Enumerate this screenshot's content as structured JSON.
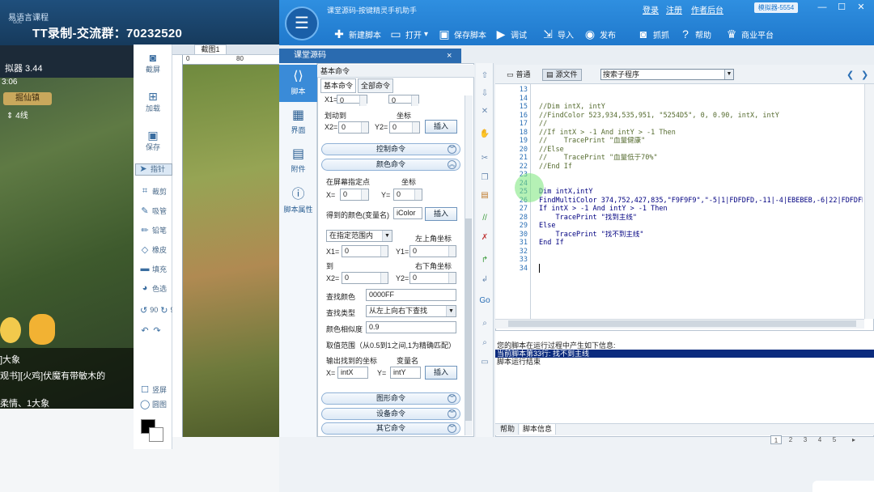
{
  "left_overlay": {
    "app_title": "易语言课程",
    "app_sub": "doc",
    "broadcast": "TT录制-交流群：70232520",
    "emulator_name": "拟器 3.44",
    "time": "3:06",
    "place": "掘仙镇",
    "line": "4线",
    "chat": [
      "]大象",
      "观书][火鸡]伏魔有带敏木的",
      "柔情、1大象"
    ]
  },
  "capture_tool": {
    "tools_top": [
      {
        "label": "截屏",
        "icon": "camera-icon"
      },
      {
        "label": "加载",
        "icon": "add-icon"
      },
      {
        "label": "保存",
        "icon": "save-icon"
      }
    ],
    "tools": [
      {
        "label": "指针",
        "icon": "pointer-icon"
      },
      {
        "label": "裁剪",
        "icon": "crop-icon"
      },
      {
        "label": "吸管",
        "icon": "eyedropper-icon"
      },
      {
        "label": "铅笔",
        "icon": "pencil-icon"
      },
      {
        "label": "橡皮",
        "icon": "eraser-icon"
      },
      {
        "label": "填充",
        "icon": "fill-icon"
      },
      {
        "label": "色选",
        "icon": "color-select-icon"
      }
    ],
    "rotate": [
      "90",
      "90"
    ],
    "vertical_label": "竖屏",
    "circle_label": "圆图",
    "tab": "截图1",
    "ruler": [
      "0",
      "80"
    ]
  },
  "header": {
    "title": "课堂源码-按键精灵手机助手",
    "links": [
      "登录",
      "注册",
      "作者后台"
    ],
    "user_badge": "模拟器-5554",
    "toolbar": [
      {
        "label": "新建脚本",
        "icon": "plus-icon"
      },
      {
        "label": "打开",
        "icon": "folder-icon"
      },
      {
        "label": "保存脚本",
        "icon": "save-icon"
      },
      {
        "label": "调试",
        "icon": "play-icon"
      },
      {
        "label": "导入",
        "icon": "import-icon"
      },
      {
        "label": "发布",
        "icon": "publish-icon"
      },
      {
        "label": "抓抓",
        "icon": "camera-icon"
      },
      {
        "label": "帮助",
        "icon": "help-icon"
      },
      {
        "label": "商业平台",
        "icon": "business-icon"
      }
    ]
  },
  "source_panel": {
    "title": "课堂源码",
    "close": "×"
  },
  "nav": [
    {
      "label": "脚本",
      "icon": "script-icon"
    },
    {
      "label": "界面",
      "icon": "ui-grid-icon"
    },
    {
      "label": "附件",
      "icon": "attachment-icon"
    },
    {
      "label": "脚本属性",
      "icon": "info-icon"
    }
  ],
  "cmd": {
    "header": "基本命令",
    "tabs": [
      "基本命令",
      "全部命令"
    ],
    "x1_top": "X1=",
    "x1_top_val": "0",
    "x1_top_val2": "0",
    "swipe_to": "划动到",
    "coord": "坐标",
    "x2": "X2=",
    "x2_val": "0",
    "y2": "Y2=",
    "y2_val": "0",
    "insert": "插入",
    "section_control": "控制命令",
    "section_color": "颜色命令",
    "point_label": "在屏幕指定点",
    "point_coord": "坐标",
    "x": "X=",
    "x_val": "0",
    "y": "Y=",
    "y_val": "0",
    "get_color_label": "得到的颜色(变量名)",
    "get_color_val": "iColor",
    "range_select": "在指定范围内",
    "top_left": "左上角坐标",
    "x1": "X1=",
    "x1_val": "0",
    "y1": "Y1=",
    "y1_val": "0",
    "to": "到",
    "bottom_right": "右下角坐标",
    "x2b": "X2=",
    "x2b_val": "0",
    "y2b": "Y2=",
    "y2b_val": "0",
    "find_color_label": "查找颜色",
    "find_color_val": "0000FF",
    "find_type_label": "查找类型",
    "find_type_val": "从左上向右下查找",
    "similarity_label": "颜色相似度",
    "similarity_val": "0.9",
    "range_note": "取值范围（从0.5到1之间,1为精确匹配）",
    "output_label": "输出找到的坐标",
    "var_name": "变量名",
    "ox": "X=",
    "ox_val": "intX",
    "oy": "Y=",
    "oy_val": "intY",
    "section_graph": "图形命令",
    "section_device": "设备命令",
    "section_other": "其它命令"
  },
  "editor": {
    "tab_normal": "普通",
    "tab_source": "源文件",
    "proc_select": "搜索子程序",
    "line_numbers": [
      "13",
      "14",
      "15",
      "16",
      "17",
      "18",
      "19",
      "20",
      "21",
      "22",
      "23",
      "24",
      "25",
      "26",
      "27",
      "28",
      "29",
      "30",
      "31",
      "32",
      "33",
      "34"
    ],
    "lines": [
      {
        "t": "",
        "c": false
      },
      {
        "t": "",
        "c": false
      },
      {
        "t": "//Dim intX, intY",
        "c": true
      },
      {
        "t": "//FindColor 523,934,535,951, \"5254D5\", 0, 0.90, intX, intY",
        "c": true
      },
      {
        "t": "//",
        "c": true
      },
      {
        "t": "//If intX > -1 And intY > -1 Then",
        "c": true
      },
      {
        "t": "//    TracePrint \"血量健康\"",
        "c": true
      },
      {
        "t": "//Else",
        "c": true
      },
      {
        "t": "//    TracePrint \"血量低于70%\"",
        "c": true
      },
      {
        "t": "//End If",
        "c": true
      },
      {
        "t": "",
        "c": false
      },
      {
        "t": "",
        "c": false
      },
      {
        "t": "Dim intX,intY",
        "c": false
      },
      {
        "t": "FindMultiColor 374,752,427,835,\"F9F9F9\",\"-5|1|FDFDFD,-11|-4|EBEBEB,-6|22|FDFDFD",
        "c": false
      },
      {
        "t": "If intX > -1 And intY > -1 Then",
        "c": false
      },
      {
        "t": "    TracePrint \"找到主线\"",
        "c": false
      },
      {
        "t": "Else",
        "c": false
      },
      {
        "t": "    TracePrint \"找不到主线\"",
        "c": false
      },
      {
        "t": "End If",
        "c": false
      },
      {
        "t": "",
        "c": false
      },
      {
        "t": "",
        "c": false
      },
      {
        "t": "",
        "c": false
      }
    ]
  },
  "output": {
    "line1": "您的脚本在运行过程中产生如下信息:",
    "line2": "当前脚本第33行: 找不到主线",
    "line3": "脚本运行结束",
    "tabs": [
      "帮助",
      "脚本信息"
    ]
  },
  "pager": [
    "1",
    "2",
    "3",
    "4",
    "5"
  ],
  "colors": {
    "accent": "#1f78cc",
    "nav_active": "#3a8bd8",
    "highlight": "#0b2b7e"
  }
}
